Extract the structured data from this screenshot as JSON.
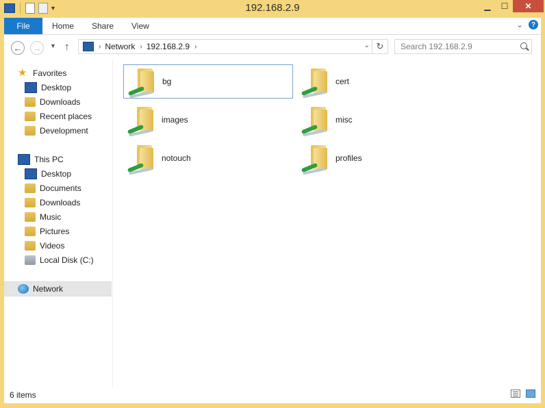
{
  "window": {
    "title": "192.168.2.9"
  },
  "ribbon": {
    "file": "File",
    "tabs": [
      "Home",
      "Share",
      "View"
    ]
  },
  "address": {
    "root": "Network",
    "current": "192.168.2.9"
  },
  "search": {
    "placeholder": "Search 192.168.2.9"
  },
  "nav": {
    "favorites": {
      "label": "Favorites",
      "items": [
        "Desktop",
        "Downloads",
        "Recent places",
        "Development"
      ]
    },
    "thispc": {
      "label": "This PC",
      "items": [
        "Desktop",
        "Documents",
        "Downloads",
        "Music",
        "Pictures",
        "Videos",
        "Local Disk (C:)"
      ]
    },
    "network": "Network"
  },
  "files": [
    "bg",
    "cert",
    "images",
    "misc",
    "notouch",
    "profiles"
  ],
  "status": {
    "count": "6 items"
  }
}
